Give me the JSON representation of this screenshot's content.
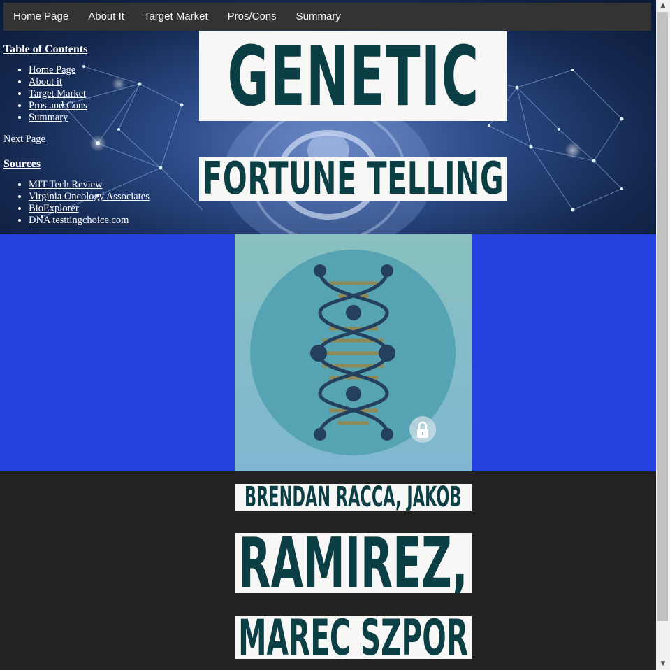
{
  "nav": {
    "items": [
      {
        "label": "Home Page"
      },
      {
        "label": "About It"
      },
      {
        "label": "Target Market"
      },
      {
        "label": "Pros/Cons"
      },
      {
        "label": "Summary"
      }
    ]
  },
  "sidebar": {
    "toc_heading": "Table of Contents",
    "toc_items": [
      "Home Page",
      "About it",
      "Target Market",
      "Pros and Cons",
      "Summary"
    ],
    "next_page": "Next Page",
    "sources_heading": "Sources",
    "sources_items": [
      "MIT Tech Review",
      "Virginia Oncology Associates",
      "BioExplorer",
      "DNA testtingchoice.com"
    ]
  },
  "title": {
    "line1": "GENETIC",
    "line2": "FORTUNE TELLING"
  },
  "authors": {
    "line1": "BRENDAN RACCA, JAKOB",
    "line2": "RAMIREZ,",
    "line3": "MAREC SZPOR"
  },
  "colors": {
    "nav_bg": "#333333",
    "band_blue": "#2441e0",
    "title_text": "#0c3f45",
    "page_bg": "#222222"
  },
  "icons": {
    "dna": "dna-helix-icon",
    "lock": "lock-icon",
    "scroll_up": "scroll-up-arrow",
    "scroll_down": "scroll-down-arrow"
  }
}
